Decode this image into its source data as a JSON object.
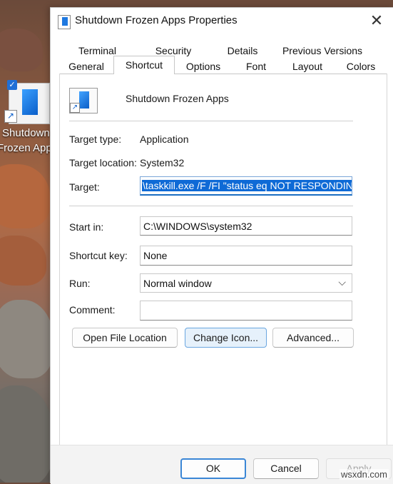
{
  "desktop": {
    "icon_label_line1": "Shutdown",
    "icon_label_line2": "Frozen Apps"
  },
  "window": {
    "title": "Shutdown Frozen Apps Properties",
    "close_glyph": "✕"
  },
  "tabs": {
    "row1": [
      "Terminal",
      "Security",
      "Details",
      "Previous Versions"
    ],
    "row2": [
      "General",
      "Shortcut",
      "Options",
      "Font",
      "Layout",
      "Colors"
    ],
    "active": "Shortcut"
  },
  "shortcut": {
    "name": "Shutdown Frozen Apps",
    "target_type_label": "Target type:",
    "target_type_value": "Application",
    "target_location_label": "Target location:",
    "target_location_value": "System32",
    "target_label": "Target:",
    "target_value": "\\taskkill.exe /F /FI \"status eq NOT RESPONDING\"",
    "start_in_label": "Start in:",
    "start_in_value": "C:\\WINDOWS\\system32",
    "shortcut_key_label": "Shortcut key:",
    "shortcut_key_value": "None",
    "run_label": "Run:",
    "run_value": "Normal window",
    "comment_label": "Comment:",
    "comment_value": ""
  },
  "buttons": {
    "open_file_location": "Open File Location",
    "change_icon": "Change Icon...",
    "advanced": "Advanced...",
    "ok": "OK",
    "cancel": "Cancel",
    "apply": "Apply"
  },
  "watermark": "wsxdn.com"
}
